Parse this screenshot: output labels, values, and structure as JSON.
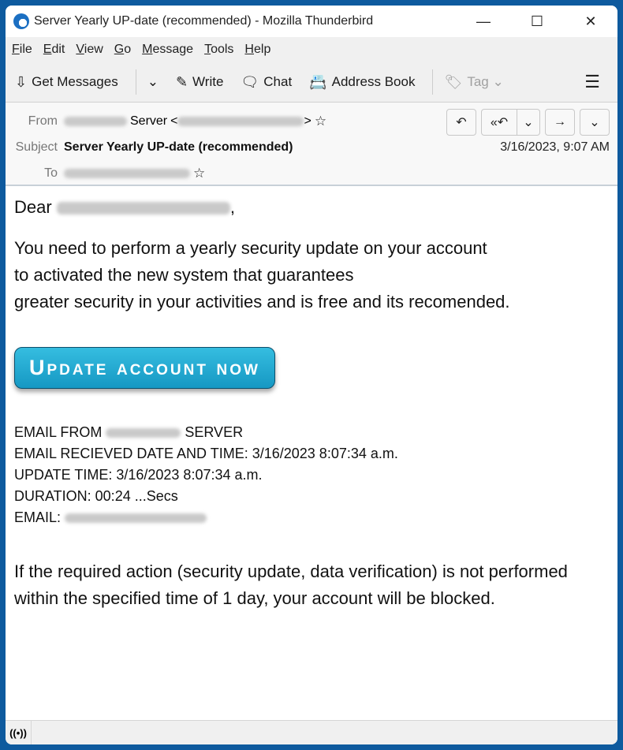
{
  "window": {
    "title": "Server Yearly UP-date (recommended) - Mozilla Thunderbird",
    "controls": {
      "minimize": "—",
      "maximize": "☐",
      "close": "✕"
    }
  },
  "menu": [
    {
      "key": "F",
      "rest": "ile"
    },
    {
      "key": "E",
      "rest": "dit"
    },
    {
      "key": "V",
      "rest": "iew"
    },
    {
      "key": "G",
      "rest": "o"
    },
    {
      "key": "M",
      "rest": "essage"
    },
    {
      "key": "T",
      "rest": "ools"
    },
    {
      "key": "H",
      "rest": "elp"
    }
  ],
  "toolbar": {
    "get_messages": "Get Messages",
    "write": "Write",
    "chat": "Chat",
    "address_book": "Address Book",
    "tag": "Tag"
  },
  "header": {
    "from_label": "From",
    "from_name": "Server",
    "subject_label": "Subject",
    "subject": "Server Yearly UP-date (recommended)",
    "to_label": "To",
    "date": "3/16/2023, 9:07 AM"
  },
  "body": {
    "greeting": "Dear",
    "para1": [
      "You need to perform a yearly security update on your account",
      "to activated the new system that guarantees",
      "greater security in your activities and is free and its recomended."
    ],
    "cta": "Update account now",
    "meta": {
      "from_prefix": "EMAIL FROM",
      "from_suffix": "SERVER",
      "received": "EMAIL RECIEVED DATE AND TIME:  3/16/2023 8:07:34 a.m.",
      "update": "UPDATE TIME: 3/16/2023 8:07:34 a.m.",
      "duration": "DURATION: 00:24 ...Secs",
      "email_label": "EMAIL:"
    },
    "warning": "If the required action (security update, data verification) is not performed within the specified time of 1 day, your account will be blocked."
  }
}
